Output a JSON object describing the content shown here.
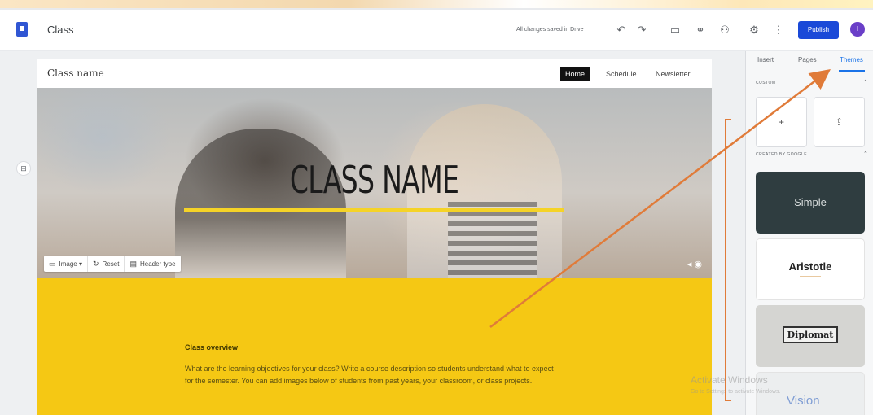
{
  "app": {
    "title": "Class",
    "save_status": "All changes saved in Drive",
    "publish_label": "Publish",
    "avatar_initial": "I",
    "toolbar_icons": [
      "undo-icon",
      "redo-icon",
      "preview-icon",
      "link-icon",
      "share-icon",
      "settings-icon",
      "more-icon"
    ]
  },
  "site": {
    "name": "Class name",
    "nav": [
      {
        "label": "Home",
        "active": true
      },
      {
        "label": "Schedule",
        "active": false
      },
      {
        "label": "Newsletter",
        "active": false
      }
    ],
    "hero": {
      "title": "CLASS NAME",
      "tools": [
        {
          "icon": "image-icon",
          "label": "Image ▾"
        },
        {
          "icon": "reset-icon",
          "label": "Reset"
        },
        {
          "icon": "header-type-icon",
          "label": "Header type"
        }
      ]
    },
    "overview": {
      "title": "Class overview",
      "body": "What are the learning objectives for your class? Write a course description so students understand what to expect for the semester. You can add images below of students from past years, your classroom, or class projects."
    }
  },
  "panel": {
    "tabs": [
      {
        "label": "Insert",
        "active": false
      },
      {
        "label": "Pages",
        "active": false
      },
      {
        "label": "Themes",
        "active": true
      }
    ],
    "custom_label": "CUSTOM",
    "google_label": "CREATED BY GOOGLE",
    "themes": [
      "Simple",
      "Aristotle",
      "Diplomat"
    ]
  },
  "overlay": {
    "activate_title": "Activate Windows",
    "activate_sub": "Go to Settings to activate Windows.",
    "watermark": "Vision",
    "accent": "#e07b39"
  }
}
